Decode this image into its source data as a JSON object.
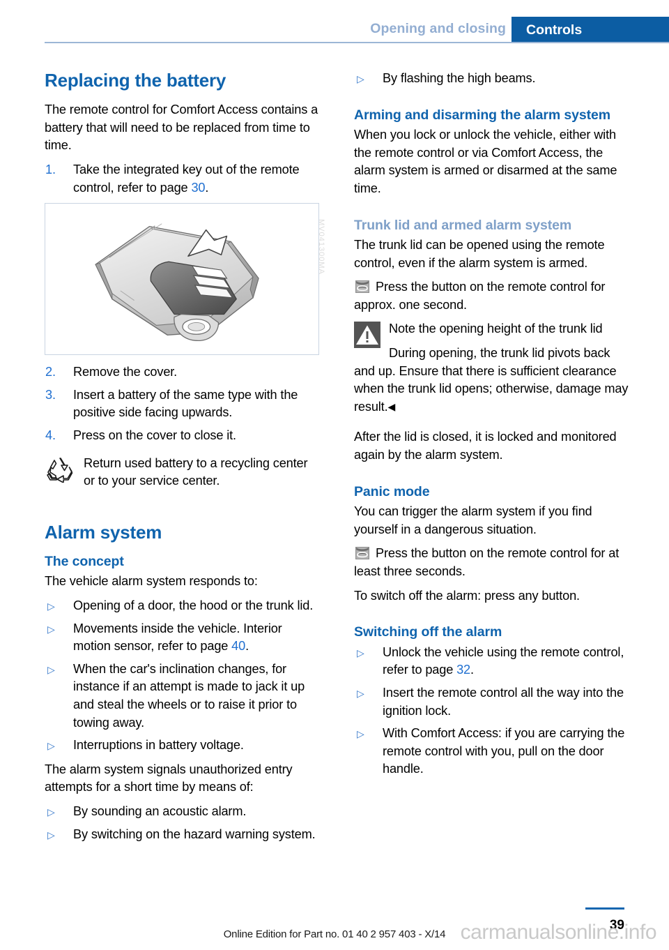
{
  "header": {
    "chapter": "Opening and closing",
    "section_tab": "Controls"
  },
  "left_column": {
    "heading": "Replacing the battery",
    "intro": "The remote control for Comfort Access contains a battery that will need to be replaced from time to time.",
    "steps": [
      {
        "num": "1.",
        "text_before": "Take the integrated key out of the remote control, refer to page ",
        "page_ref": "30",
        "text_after": "."
      },
      {
        "num": "2.",
        "text_before": "Remove the cover.",
        "page_ref": "",
        "text_after": ""
      },
      {
        "num": "3.",
        "text_before": "Insert a battery of the same type with the positive side facing upwards.",
        "page_ref": "",
        "text_after": ""
      },
      {
        "num": "4.",
        "text_before": "Press on the cover to close it.",
        "page_ref": "",
        "text_after": ""
      }
    ],
    "figure": {
      "caption_code": "MV041300MA",
      "alt": "Remote control key fob with arrow showing cover being lifted off"
    },
    "recycling_note": "Return used battery to a recycling center or to your service center.",
    "alarm_heading": "Alarm system",
    "concept_heading": "The concept",
    "concept_intro": "The vehicle alarm system responds to:",
    "concept_bullets": [
      {
        "text_before": "Opening of a door, the hood or the trunk lid.",
        "page_ref": "",
        "text_after": ""
      },
      {
        "text_before": "Movements inside the vehicle. Interior motion sensor, refer to page ",
        "page_ref": "40",
        "text_after": "."
      },
      {
        "text_before": "When the car's inclination changes, for instance if an attempt is made to jack it up and steal the wheels or to raise it prior to towing away.",
        "page_ref": "",
        "text_after": ""
      },
      {
        "text_before": "Interruptions in battery voltage.",
        "page_ref": "",
        "text_after": ""
      }
    ],
    "signals_intro": "The alarm system signals unauthorized entry attempts for a short time by means of:",
    "signals_bullets": [
      {
        "text_before": "By sounding an acoustic alarm.",
        "page_ref": "",
        "text_after": ""
      },
      {
        "text_before": "By switching on the hazard warning system.",
        "page_ref": "",
        "text_after": ""
      }
    ]
  },
  "right_column": {
    "continued_bullet": {
      "text_before": "By flashing the high beams.",
      "page_ref": "",
      "text_after": ""
    },
    "arming_heading": "Arming and disarming the alarm system",
    "arming_body": "When you lock or unlock the vehicle, either with the remote control or via Comfort Access, the alarm system is armed or disarmed at the same time.",
    "trunk_heading": "Trunk lid and armed alarm system",
    "trunk_body": "The trunk lid can be opened using the remote control, even if the alarm system is armed.",
    "trunk_action": "Press the button on the remote control for approx. one second.",
    "warning_title": "Note the opening height of the trunk lid",
    "warning_body": "During opening, the trunk lid pivots back and up. Ensure that there is sufficient clearance when the trunk lid opens; otherwise, damage may result.",
    "warning_endmark": "◀",
    "after_lid_body": "After the lid is closed, it is locked and monitored again by the alarm system.",
    "panic_heading": "Panic mode",
    "panic_body": "You can trigger the alarm system if you find yourself in a dangerous situation.",
    "panic_action": "Press the button on the remote control for at least three seconds.",
    "panic_switchoff": "To switch off the alarm: press any button.",
    "switching_heading": "Switching off the alarm",
    "switching_bullets": [
      {
        "text_before": "Unlock the vehicle using the remote control, refer to page ",
        "page_ref": "32",
        "text_after": "."
      },
      {
        "text_before": "Insert the remote control all the way into the ignition lock.",
        "page_ref": "",
        "text_after": ""
      },
      {
        "text_before": "With Comfort Access: if you are carrying the remote control with you, pull on the door handle.",
        "page_ref": "",
        "text_after": ""
      }
    ]
  },
  "footer": {
    "edition": "Online Edition for Part no. 01 40 2 957 403 - X/14",
    "page_number": "39",
    "watermark": "carmanualsonline.info"
  },
  "colors": {
    "tab_blue": "#0c5da3",
    "heading_blue": "#0f63ad",
    "muted_blue": "#7fa0c8",
    "link_blue": "#1f6fd0",
    "rule_blue": "#9cb6d6"
  }
}
